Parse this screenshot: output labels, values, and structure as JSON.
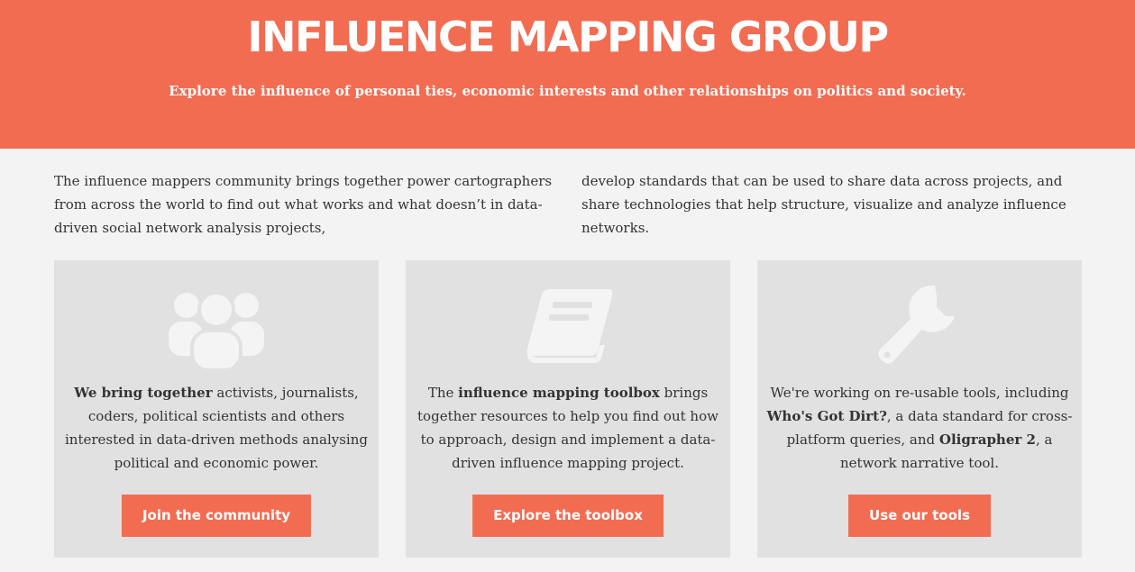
{
  "header": {
    "title": "INFLUENCE MAPPING GROUP",
    "subtitle": "Explore the influence of personal ties, economic interests and other relationships on politics and society."
  },
  "intro": {
    "left": "The influence mappers community brings together power cartographers from across the world to find out what works and what doesn’t in data-driven social network analysis projects,",
    "right": "develop standards that can be used to share data across projects, and share technologies that help structure, visualize and analyze influence networks."
  },
  "cards": [
    {
      "icon": "users-icon",
      "text_bold": "We bring together",
      "text_rest": " activists, journalists, coders, political scientists and others interested in data-driven methods analysing political and economic power.",
      "button": "Join the community"
    },
    {
      "icon": "book-icon",
      "text_pre": "The ",
      "text_bold": "influence mapping toolbox",
      "text_rest": " brings together resources to help you find out how to approach, design and implement a data-driven influence mapping project.",
      "button": "Explore the toolbox"
    },
    {
      "icon": "wrench-icon",
      "text_pre": "We're working on re-usable tools, including ",
      "text_bold": "Who's Got Dirt?",
      "text_mid": ", a data standard for cross-platform queries, and ",
      "text_bold2": "Oligrapher 2",
      "text_rest": ", a network narrative tool.",
      "button": "Use our tools"
    }
  ],
  "colors": {
    "accent": "#f26c52",
    "background": "#f3f3f3",
    "card": "#e1e1e1",
    "icon": "#f4f4f4"
  }
}
